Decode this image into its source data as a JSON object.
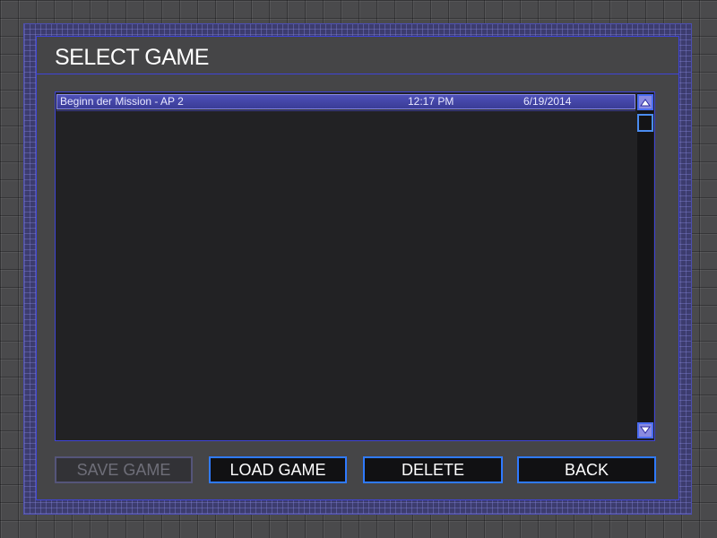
{
  "dialog": {
    "title": "SELECT GAME"
  },
  "saves": [
    {
      "name": "Beginn der Mission - AP 2",
      "time": "12:17 PM",
      "date": "6/19/2014",
      "selected": true
    }
  ],
  "buttons": {
    "save": {
      "label": "SAVE GAME",
      "enabled": false
    },
    "load": {
      "label": "LOAD GAME",
      "enabled": true
    },
    "delete": {
      "label": "DELETE",
      "enabled": true
    },
    "back": {
      "label": "BACK",
      "enabled": true
    }
  },
  "icons": {
    "scroll_up": "triangle-up-icon",
    "scroll_down": "triangle-down-icon"
  },
  "colors": {
    "accent": "#3f44d8",
    "selection": "#4e50b8",
    "button_border": "#2f7aff"
  }
}
